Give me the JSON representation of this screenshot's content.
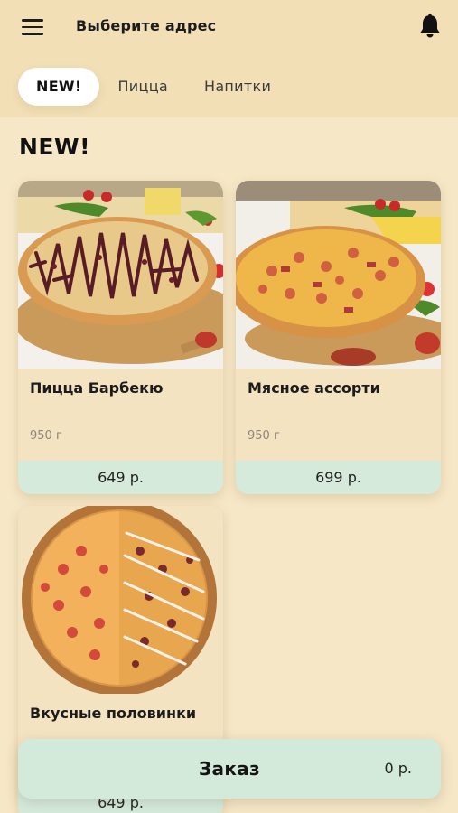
{
  "header": {
    "address_label": "Выберите адрес",
    "menu_icon": "hamburger-menu-icon",
    "bell_icon": "bell-icon"
  },
  "tabs": [
    {
      "label": "NEW!",
      "active": true
    },
    {
      "label": "Пицца",
      "active": false
    },
    {
      "label": "Напитки",
      "active": false
    }
  ],
  "section": {
    "title": "NEW!"
  },
  "products": [
    {
      "name": "Пицца Барбекю",
      "weight": "950 г",
      "price": "649 р."
    },
    {
      "name": "Мясное ассорти",
      "weight": "950 г",
      "price": "699 р."
    },
    {
      "name": "Вкусные половинки",
      "weight": "",
      "price": "649 р."
    }
  ],
  "order": {
    "label": "Заказ",
    "total": "0 р."
  },
  "colors": {
    "background": "#f6e7c6",
    "header": "#f2dfb6",
    "price_bar": "#d6eadc",
    "order_bar": "#d3e9da",
    "tab_active": "#ffffff"
  }
}
